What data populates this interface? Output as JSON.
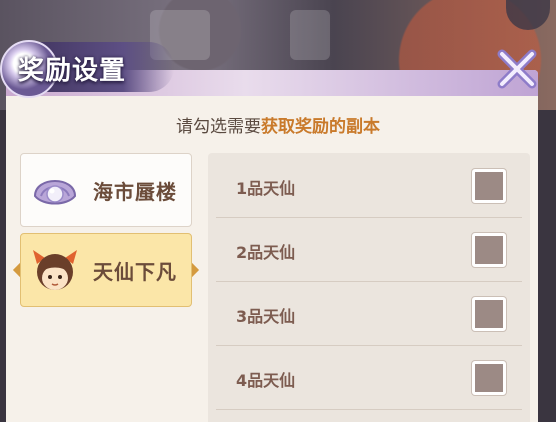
{
  "dialog": {
    "title": "奖励设置",
    "close_icon": "close-x-icon"
  },
  "instruction": {
    "prefix": "请勾选需要",
    "highlight": "获取奖励的副本"
  },
  "tabs": [
    {
      "label": "海市蜃楼",
      "icon": "pearl-shell-icon",
      "selected": false
    },
    {
      "label": "天仙下凡",
      "icon": "character-avatar-icon",
      "selected": true
    }
  ],
  "rows": [
    {
      "label": "1品天仙",
      "checked": false
    },
    {
      "label": "2品天仙",
      "checked": false
    },
    {
      "label": "3品天仙",
      "checked": false
    },
    {
      "label": "4品天仙",
      "checked": false
    }
  ],
  "colors": {
    "highlight": "#c97a2b",
    "selected_tab": "#fbe6a8",
    "checkbox_fill": "#9c8a85"
  }
}
